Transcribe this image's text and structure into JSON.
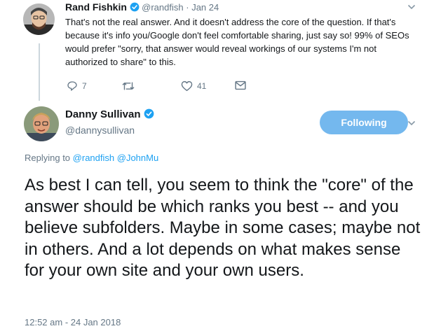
{
  "parent_tweet": {
    "author_name": "Rand Fishkin",
    "author_handle": "@randfish",
    "separator": "·",
    "date": "Jan 24",
    "text": "That's not the real answer. And it doesn't address the core of the question. If that's because it's info you/Google don't feel comfortable sharing, just say so! 99% of SEOs would prefer \"sorry, that answer would reveal workings of our systems I'm not authorized to share\" to this.",
    "actions": {
      "reply_count": "7",
      "retweet_count": "",
      "like_count": "41"
    }
  },
  "main_tweet": {
    "author_name": "Danny Sullivan",
    "author_handle": "@dannysullivan",
    "follow_button_label": "Following",
    "replying_prefix": "Replying to",
    "replying_to": [
      "@randfish",
      "@JohnMu"
    ],
    "text": "As best I can tell, you seem to think the \"core\" of the answer should be which ranks you best -- and you believe subfolders. Maybe in some cases; maybe not in others. And a lot depends on what makes sense for your own site and your own users.",
    "timestamp": "12:52 am - 24 Jan 2018"
  },
  "colors": {
    "accent": "#1da1f2",
    "follow_button": "#74b8ee",
    "secondary_text": "#657786",
    "thread_line": "#ccd6dd"
  },
  "icons": [
    "reply-icon",
    "retweet-icon",
    "like-icon",
    "direct-message-icon",
    "verified-badge-icon",
    "chevron-down-icon"
  ]
}
